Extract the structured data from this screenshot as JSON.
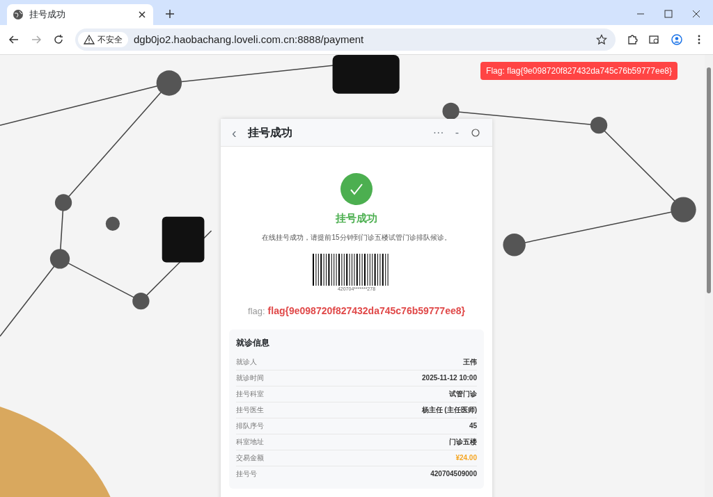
{
  "browser": {
    "tab_title": "挂号成功",
    "security_label": "不安全",
    "url": "dgb0jo2.haobachang.loveli.com.cn:8888/payment"
  },
  "toast": {
    "text": "Flag: flag{9e098720f827432da745c76b59777ee8}"
  },
  "card": {
    "back": "‹",
    "title": "挂号成功",
    "more": "···",
    "minimize": "-",
    "success_title": "挂号成功",
    "message": "在线挂号成功，请提前15分钟到门诊五楼试管门诊排队候诊。",
    "barcode_number": "420704*******278",
    "flag_label": "flag:",
    "flag_value": "flag{9e098720f827432da745c76b59777ee8}",
    "info_title": "就诊信息",
    "rows": [
      {
        "label": "就诊人",
        "value": "王伟",
        "kind": "plain"
      },
      {
        "label": "就诊时间",
        "value": "2025-11-12 10:00",
        "kind": "plain"
      },
      {
        "label": "挂号科室",
        "value": "试管门诊",
        "kind": "plain"
      },
      {
        "label": "挂号医生",
        "value": "杨主任 (主任医师)",
        "kind": "plain"
      },
      {
        "label": "排队序号",
        "value": "45",
        "kind": "plain"
      },
      {
        "label": "科室地址",
        "value": "门诊五楼",
        "kind": "plain"
      },
      {
        "label": "交易金额",
        "value": "¥24.00",
        "kind": "price"
      },
      {
        "label": "挂号号",
        "value": "420704509000",
        "kind": "plain"
      }
    ]
  }
}
